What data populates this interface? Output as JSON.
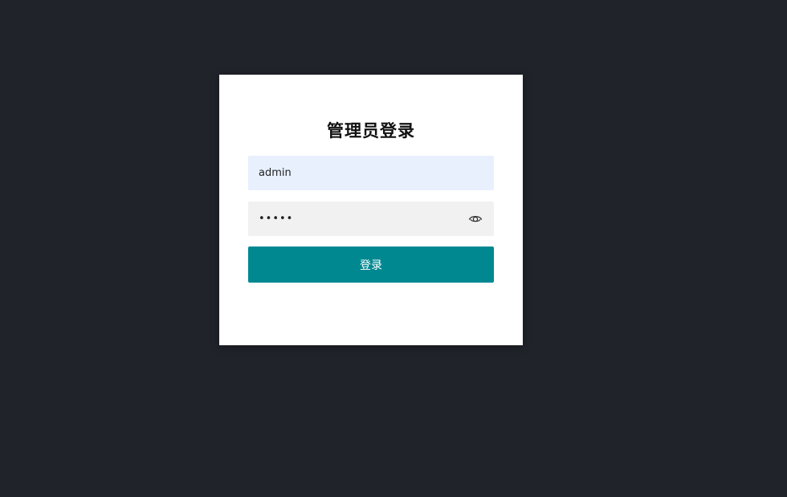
{
  "login": {
    "title": "管理员登录",
    "username_value": "admin",
    "password_value": "admin",
    "login_button": "登录",
    "eye_icon": "eye-icon"
  },
  "colors": {
    "background": "#20232a",
    "card": "#ffffff",
    "button": "#008891",
    "username_bg": "#e8f0fe",
    "password_bg": "#f1f1f1"
  }
}
